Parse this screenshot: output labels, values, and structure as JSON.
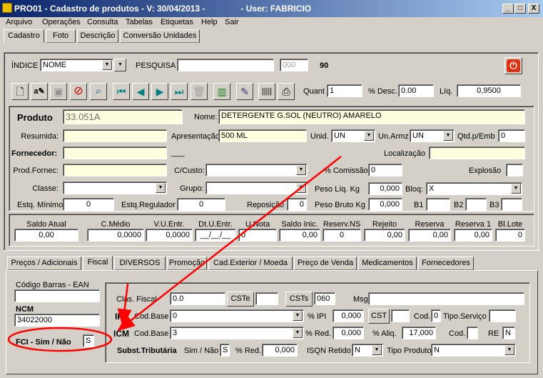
{
  "window": {
    "title": "PRO01 - Cadastro de produtos - V: 30/04/2013 -               - User: FABRICIO",
    "minimize": "_",
    "maximize": "□",
    "close": "X"
  },
  "menu": [
    "Arquivo",
    "Operações",
    "Consulta",
    "Tabelas",
    "Etiquetas",
    "Help",
    "Sair"
  ],
  "top_tabs": [
    "Cadastro",
    "Foto",
    "Descrição",
    "Conversão Unidades"
  ],
  "search": {
    "indice_label": "ÍNDICE",
    "indice_value": "NOME",
    "pesquisa_label": "PESQUISA",
    "pesquisa_value": "",
    "code_value": "000",
    "count": "90"
  },
  "toolbar": {
    "icons": [
      "new-document-icon",
      "find-replace-icon",
      "save-icon",
      "cancel-icon",
      "search-icon",
      "first-record-icon",
      "previous-record-icon",
      "next-record-icon",
      "last-record-icon",
      "delete-icon",
      "books-icon",
      "edit-note-icon",
      "barcode-icon",
      "printer-icon"
    ],
    "quant_label": "Quant",
    "quant_value": "1",
    "desc_label": "% Desc.",
    "desc_value": "0.00",
    "liq_label": "Líq.",
    "liq_value": "0,9500"
  },
  "product": {
    "produto_label": "Produto",
    "produto_value": "33.051A",
    "nome_label": "Nome:",
    "nome_value": "DETERGENTE G.SOL (NEUTRO) AMARELO",
    "resumida_label": "Resumida:",
    "resumida_value": "",
    "apresentacao_label": "Apresentação",
    "apresentacao_value": "500 ML",
    "unid_label": "Unid.",
    "unid_value": "UN",
    "unarmz_label": "Un.Armz",
    "unarmz_value": "UN",
    "qtdemb_label": "Qtd.p/Emb",
    "qtdemb_value": "0",
    "fornecedor_label": "Fornecedor:",
    "fornecedor_value": "",
    "fornecedor_dash": "___",
    "localizacao_label": "Localização",
    "localizacao_value": "",
    "prodfornec_label": "Prod.Fornec:",
    "prodfornec_value": "",
    "ccusto_label": "C/Custo:",
    "ccusto_value": "",
    "comissao_label": "% Comissão",
    "comissao_value": "0",
    "explosao_label": "Explosão",
    "explosao_value": "",
    "classe_label": "Classe:",
    "classe_value": "",
    "grupo_label": "Grupo:",
    "grupo_value": "",
    "pesoliq_label": "Peso Líq. Kg",
    "pesoliq_value": "0,000",
    "bloq_label": "Bloq:",
    "bloq_value": "X",
    "estqmin_label": "Estq. Mínimo",
    "estqmin_value": "0",
    "estqreg_label": "Estq.Regulador",
    "estqreg_value": "0",
    "reposicao_label": "Reposição",
    "reposicao_value": "0",
    "pesobruto_label": "Peso Bruto Kg",
    "pesobruto_value": "0,000",
    "b1_label": "B1",
    "b2_label": "B2",
    "b3_label": "B3"
  },
  "stock": {
    "headers": [
      "Saldo Atual",
      "C.Médio",
      "V.U.Entr.",
      "Dt.U.Entr.",
      "U.Nota",
      "Saldo Inic.",
      "Reserv.NS",
      "Rejeito",
      "Reserva",
      "Reserva 1",
      "Bl.Lote"
    ],
    "values": [
      "0,00",
      "0,0000",
      "0,0000",
      "__/__/__",
      "0",
      "0,00",
      "0",
      "0,00",
      "0,00",
      "0,00",
      "0"
    ]
  },
  "detail_tabs": [
    "Preços / Adicionais",
    "Fiscal",
    "DIVERSOS",
    "Promoção",
    "Cad.Exterior / Moeda",
    "Preço de Venda",
    "Medicamentos",
    "Fornecedores"
  ],
  "fiscal": {
    "barcode_label": "Código Barras - EAN",
    "barcode_value": "",
    "ncm_label": "NCM",
    "ncm_value": "34022000",
    "fci_label": "FCI - Sim / Não",
    "fci_value": "S",
    "clas_label": "Clas. Fiscal",
    "clas_value": "0.0",
    "cste_label": "CSTe",
    "cste_value": "",
    "csts_label": "CSTs",
    "csts_value": "060",
    "msg_label": "Msg",
    "msg_value": "",
    "ipi_label": "IPI",
    "ipi_codbase_label": "Cod.Base",
    "ipi_codbase_value": "0",
    "ipi_pct_label": "% IPI",
    "ipi_pct_value": "0,000",
    "cst_label": "CST",
    "cst_value": "",
    "cod_label": "Cod.",
    "cod_value": "0",
    "tiposerv_label": "Tipo.Serviço",
    "tiposerv_value": "",
    "icm_label": "ICM",
    "icm_codbase_label": "Cod.Base",
    "icm_codbase_value": "3",
    "red_label": "% Red.",
    "red_value": "0,000",
    "aliq_label": "% Aliq.",
    "aliq_value": "17,000",
    "icm_cod_label": "Cod.",
    "icm_cod_value": "",
    "re_label": "RE",
    "re_value": "N",
    "subst_label": "Subst.Tributária",
    "simnao_label": "Sim / Não",
    "simnao_value": "S",
    "subst_red_label": "% Red.",
    "subst_red_value": "0,000",
    "isqn_label": "ISQN Retido",
    "isqn_value": "N",
    "tipoprod_label": "Tipo Produto",
    "tipoprod_value": "N"
  },
  "colors": {
    "annotation": "#ff0000",
    "title_start": "#0a246a",
    "title_end": "#a6caf0",
    "highlight_field": "#ffffe0",
    "power": "#e03010"
  }
}
